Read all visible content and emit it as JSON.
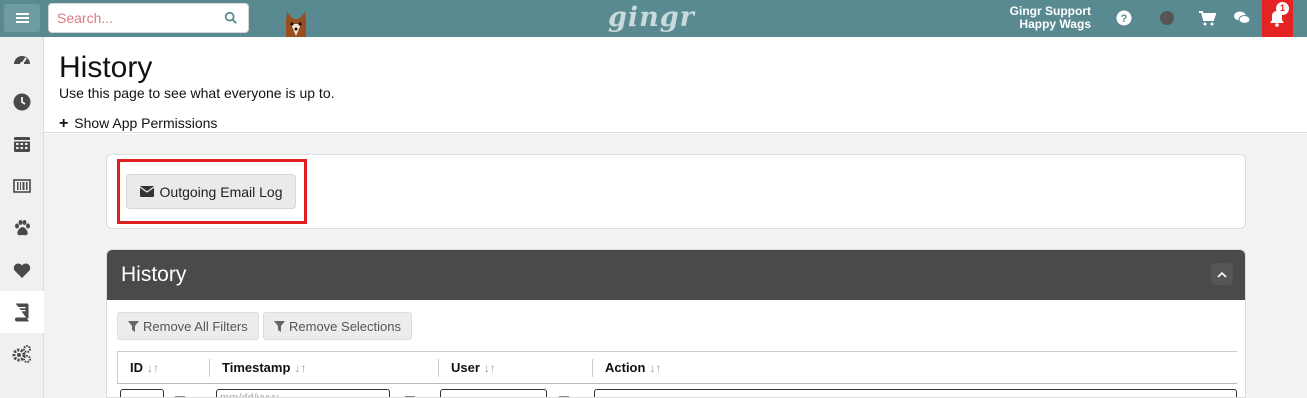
{
  "topbar": {
    "search_placeholder": "Search...",
    "logo_text": "gingr",
    "user_name": "Gingr Support",
    "location": "Happy Wags",
    "notification_count": "1",
    "accent_color": "#5a8a91",
    "icons": [
      "menu-icon",
      "search-icon",
      "help-icon",
      "status-dot",
      "cart-icon",
      "chat-icon",
      "bell-icon"
    ]
  },
  "sidebar": {
    "items": [
      {
        "name": "dashboard",
        "icon": "speedometer-icon"
      },
      {
        "name": "clock",
        "icon": "clock-icon"
      },
      {
        "name": "calendar",
        "icon": "calendar-icon"
      },
      {
        "name": "barcode",
        "icon": "barcode-icon"
      },
      {
        "name": "pets",
        "icon": "paw-icon"
      },
      {
        "name": "favorites",
        "icon": "heart-icon"
      },
      {
        "name": "history",
        "icon": "book-icon"
      },
      {
        "name": "settings",
        "icon": "gears-icon"
      }
    ],
    "active": "history"
  },
  "page": {
    "title": "History",
    "subtitle": "Use this page to see what everyone is up to.",
    "permissions_link": "Show App Permissions"
  },
  "email_log": {
    "button_label": "Outgoing Email Log"
  },
  "history_panel": {
    "title": "History",
    "remove_all_filters": "Remove All Filters",
    "remove_selections": "Remove Selections",
    "columns": [
      "ID",
      "Timestamp",
      "User",
      "Action"
    ],
    "sort_glyph": "↓↑",
    "date_placeholder": "mm/dd/yyyy"
  }
}
